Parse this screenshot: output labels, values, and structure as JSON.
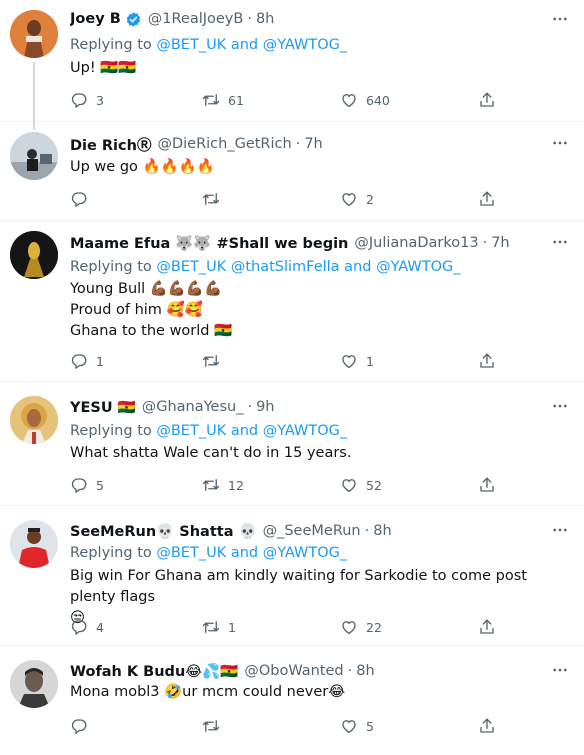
{
  "tweets": [
    {
      "name": "Joey B",
      "verified": true,
      "handle": "@1RealJoeyB",
      "time": "8h",
      "replying_prefix": "Replying to",
      "mention1": "@BET_UK",
      "joiner": "and",
      "mention2": "@YAWTOG_",
      "text": "Up! 🇬🇭🇬🇭",
      "replies": "3",
      "retweets": "61",
      "likes": "640"
    },
    {
      "name": "Die RichⓇ",
      "handle": "@DieRich_GetRich",
      "time": "7h",
      "text": "Up we go 🔥🔥🔥🔥",
      "replies": "",
      "retweets": "",
      "likes": "2"
    },
    {
      "name": "Maame Efua 🐺🐺 #Shall we begin",
      "handle": "@JulianaDarko13",
      "time": "7h",
      "replying_prefix": "Replying to",
      "mention1": "@BET_UK",
      "mention2": "@thatSlimFella",
      "joiner": "and",
      "mention3": "@YAWTOG_",
      "line1": "Young Bull 💪🏾💪🏾💪🏾💪🏾",
      "line2": "Proud of him 🥰🥰",
      "line3": "Ghana to the world 🇬🇭",
      "replies": "1",
      "retweets": "",
      "likes": "1"
    },
    {
      "name": "YESU 🇬🇭",
      "handle": "@GhanaYesu_",
      "time": "9h",
      "replying_prefix": "Replying to",
      "mention1": "@BET_UK",
      "joiner": "and",
      "mention2": "@YAWTOG_",
      "text": "What shatta Wale can't do in 15 years.",
      "replies": "5",
      "retweets": "12",
      "likes": "52"
    },
    {
      "name": "SeeMeRun💀 Shatta 💀",
      "handle": "@_SeeMeRun",
      "time": "8h",
      "replying_prefix": "Replying to",
      "mention1": "@BET_UK",
      "joiner": "and",
      "mention2": "@YAWTOG_",
      "line1": "Big win For Ghana am kindly waiting for Sarkodie to come post plenty flags",
      "line2": "😒",
      "replies": "4",
      "retweets": "1",
      "likes": "22"
    },
    {
      "name": "Wofah K Budu😂💦🇬🇭",
      "handle": "@OboWanted",
      "time": "8h",
      "text": "Mona mobl3 🤣ur mcm could never😂",
      "replies": "",
      "retweets": "",
      "likes": "5"
    }
  ],
  "separator": "·",
  "icons": {
    "reply": "reply-icon",
    "retweet": "retweet-icon",
    "like": "heart-icon",
    "share": "share-icon",
    "more": "more-icon",
    "verified": "verified-badge-icon"
  },
  "colors": {
    "mention": "#1d9bf0",
    "secondary": "#536471",
    "primary": "#0f1419",
    "verified": "#1d9bf0",
    "thread_line": "#cfd9de"
  }
}
